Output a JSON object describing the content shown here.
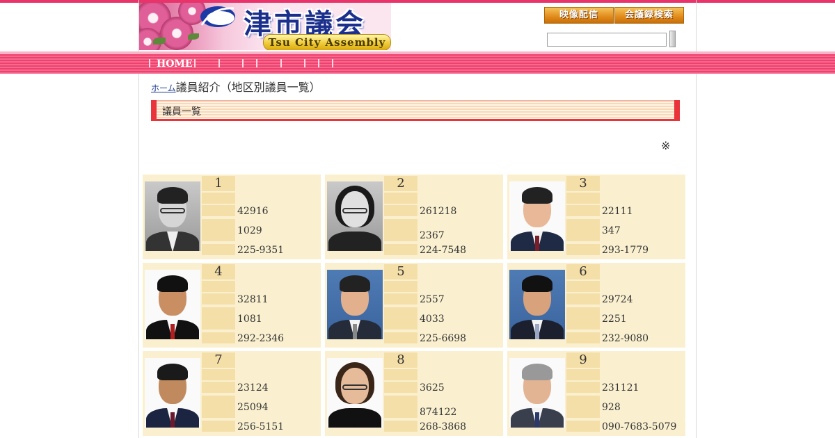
{
  "header": {
    "title_jp": "津市議会",
    "title_en": "Tsu City Assembly",
    "btn_video": "映像配信",
    "btn_search": "会議録検索",
    "search_value": ""
  },
  "nav": {
    "home": "HOME"
  },
  "breadcrumb": {
    "link": "ホーム",
    "current": "議員紹介（地区別議員一覧）"
  },
  "section": {
    "title": "議員一覧"
  },
  "note": "※",
  "colors": {
    "brand_pink": "#e8346a",
    "card_bg": "#faf0d0",
    "label_bg": "#f5dfa8",
    "section_bar": "#e8343a"
  },
  "members": [
    {
      "num": "1",
      "v1": "42916",
      "v2": "1029",
      "v3": "225-9351"
    },
    {
      "num": "2",
      "v1": "261218",
      "v2": "2367",
      "v3": "224-7548"
    },
    {
      "num": "3",
      "v1": "22111",
      "v2": "347",
      "v3": "293-1779"
    },
    {
      "num": "4",
      "v1": "32811",
      "v2": "1081",
      "v3": "292-2346"
    },
    {
      "num": "5",
      "v1": "2557",
      "v2": "4033",
      "v3": "225-6698"
    },
    {
      "num": "6",
      "v1": "29724",
      "v2": "2251",
      "v3": "232-9080"
    },
    {
      "num": "7",
      "v1": "23124",
      "v2": "25094",
      "v3": "256-5151"
    },
    {
      "num": "8",
      "v1": "3625",
      "v2": "874122",
      "v3": "268-3868"
    },
    {
      "num": "9",
      "v1": "231121",
      "v2": "928",
      "v3": "090-7683-5079"
    }
  ]
}
